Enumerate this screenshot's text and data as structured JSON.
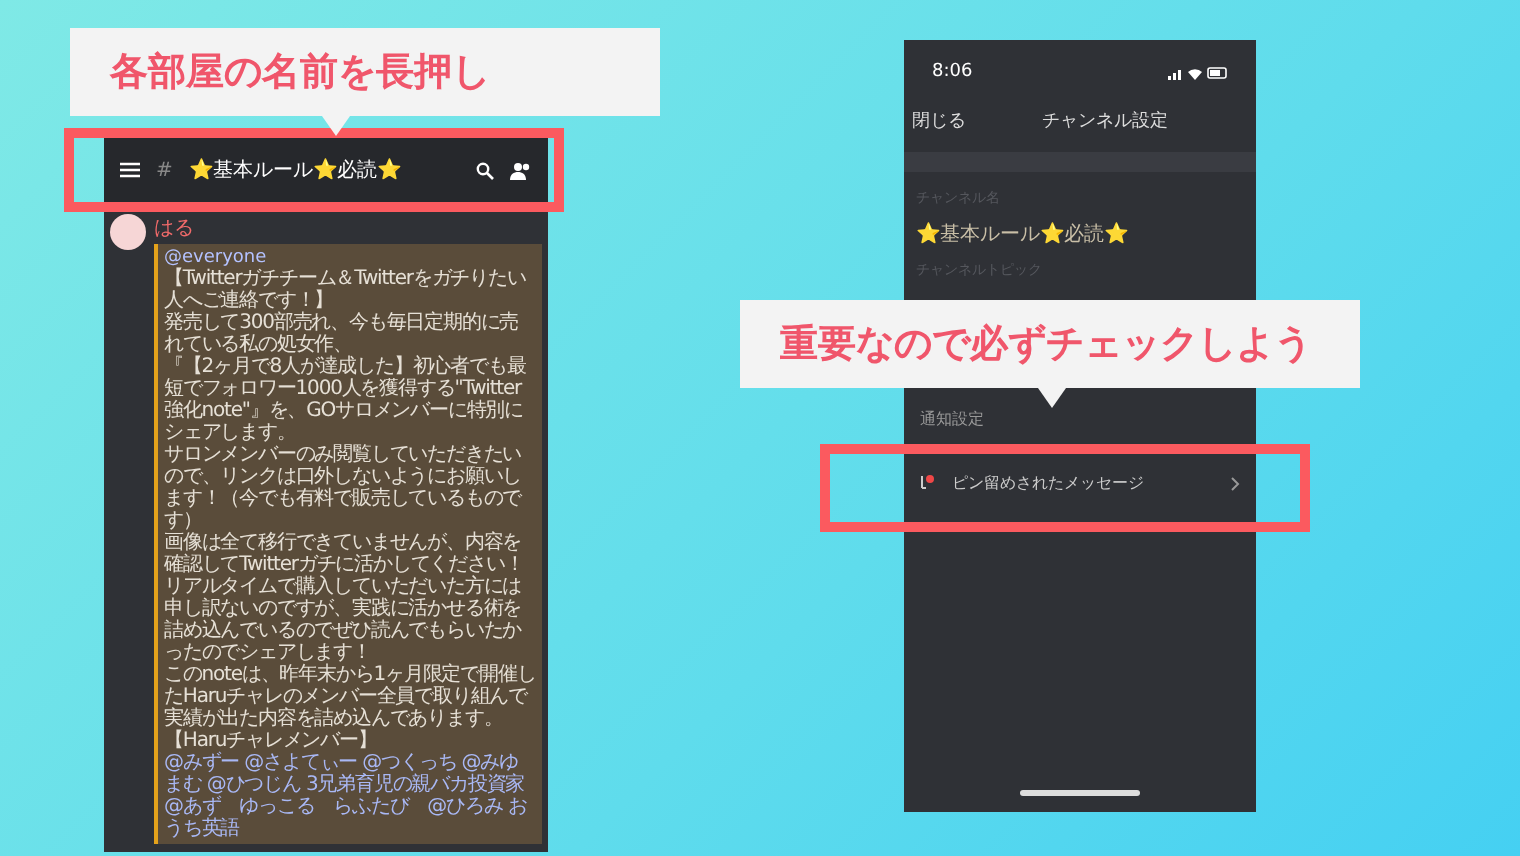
{
  "callouts": [
    {
      "text": "各部屋の名前を長押し"
    },
    {
      "text": "重要なので必ずチェックしよう"
    }
  ],
  "chat_screen": {
    "channel_hash": "#",
    "channel_name": "⭐基本ルール⭐必読⭐",
    "author": "はる",
    "mention_tag": "@everyone",
    "paragraphs": [
      "【Twitterガチチーム＆Twitterをガチりたい人へご連絡です！】",
      "発売して300部売れ、今も毎日定期的に売れている私の処女作、",
      "『【2ヶ月で8人が達成した】初心者でも最短でフォロワー1000人を獲得する\"Twitter強化note\"』を、GOサロメンバーに特別にシェアします。",
      "サロンメンバーのみ閲覧していただきたいので、リンクは口外しないようにお願いします！（今でも有料で販売しているものです）",
      "画像は全て移行できていませんが、内容を確認してTwitterガチに活かしてください！",
      "リアルタイムで購入していただいた方には申し訳ないのですが、実践に活かせる術を詰め込んでいるのでぜひ読んでもらいたかったのでシェアします！",
      "このnoteは、昨年末から1ヶ月限定で開催したHaruチャレのメンバー全員で取り組んで実績が出た内容を詰め込んであります。【Haruチャレメンバー】"
    ],
    "mentions": "@みずー @さよてぃー @つくっち @みゆまむ @ひつじん 3兄弟育児の親バカ投資家 @あず　ゆっこる　らふたび　@ひろみ おうち英語"
  },
  "settings_screen": {
    "time": "8:06",
    "close": "閉じる",
    "title": "チャンネル設定",
    "name_label": "チャンネル名",
    "name_value": "⭐基本ルール⭐必読⭐",
    "topic_label": "チャンネルトピック",
    "notify_label": "通知設定",
    "pinned_label": "ピン留めされたメッセージ"
  }
}
